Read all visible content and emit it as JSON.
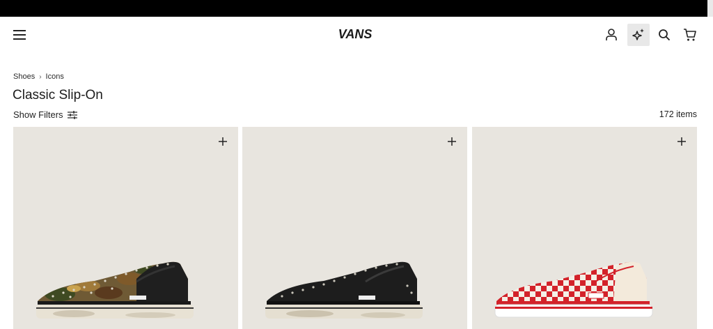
{
  "header": {
    "brand": "VANS",
    "icons": [
      "menu-icon",
      "account-icon",
      "sparkle-icon",
      "search-icon",
      "cart-icon"
    ]
  },
  "breadcrumb": {
    "items": [
      "Shoes",
      "Icons"
    ],
    "separator": "›"
  },
  "page": {
    "title": "Classic Slip-On",
    "filters_label": "Show Filters",
    "item_count": "172 items"
  },
  "products": [
    {
      "image": "camo studded slip-on shoe",
      "action_icon": "plus-icon"
    },
    {
      "image": "black studded slip-on shoe",
      "action_icon": "plus-icon"
    },
    {
      "image": "red and white checkerboard slip-on shoe",
      "action_icon": "plus-icon"
    }
  ],
  "colors": {
    "topbar": "#000000",
    "card_background": "#e8e5df",
    "ai_button_background": "#e8e8e8",
    "checker_red": "#d3222a"
  }
}
